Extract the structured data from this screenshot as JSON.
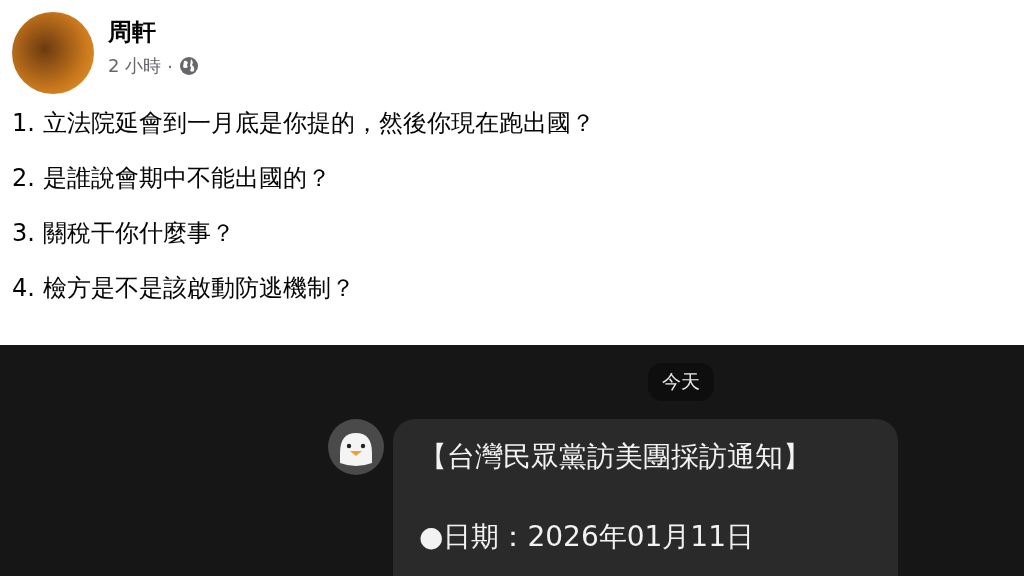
{
  "post": {
    "author": "周軒",
    "time": "2 小時",
    "separator": "·",
    "lines": [
      "1. 立法院延會到一月底是你提的，然後你現在跑出國？",
      "2. 是誰說會期中不能出國的？",
      "3. 關稅干你什麼事？",
      "4. 檢方是不是該啟動防逃機制？"
    ]
  },
  "chat": {
    "date_label": "今天",
    "message": {
      "title": "【台灣民眾黨訪美團採訪通知】",
      "date_line": "●日期：2026年01月11日"
    }
  }
}
